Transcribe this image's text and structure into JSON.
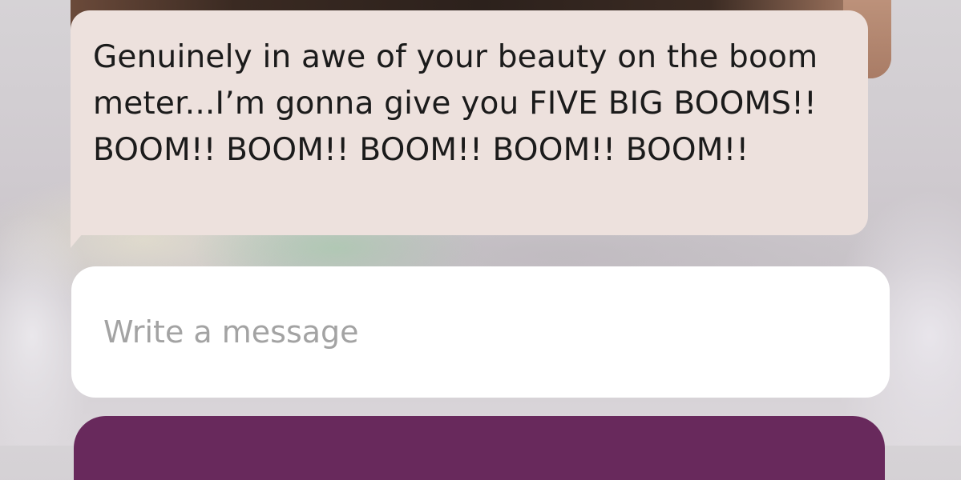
{
  "conversation": {
    "message": {
      "text": "Genuinely in awe of your beauty on the boom meter...I’m gonna give you FIVE BIG BOOMS!! BOOM!! BOOM!! BOOM!! BOOM!! BOOM!!"
    }
  },
  "composer": {
    "placeholder": "Write a message",
    "value": ""
  },
  "colors": {
    "bubble_background": "#ede1dd",
    "composer_background": "#ffffff",
    "send_bar": "#68295c",
    "placeholder_text": "#a3a3a3"
  }
}
